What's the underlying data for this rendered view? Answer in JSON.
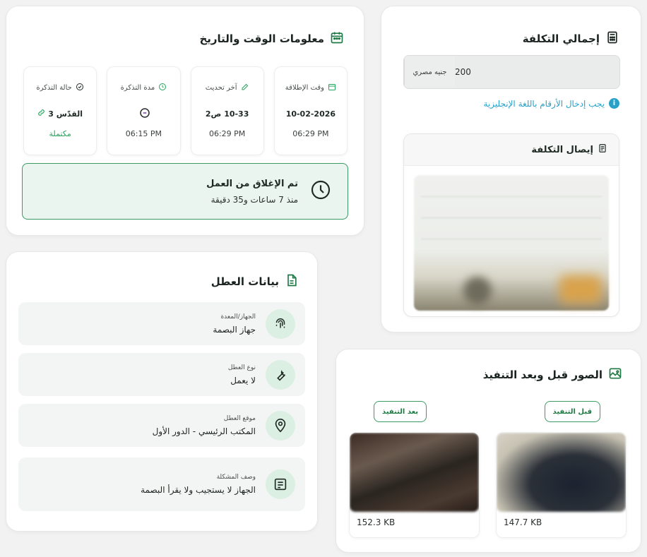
{
  "time_card": {
    "title": "معلومات الوقت والتاريخ",
    "stats": [
      {
        "label": "وقت الإطلاقة",
        "value": "10-02-2026",
        "sub": "06:29 PM"
      },
      {
        "label": "آخر تحديث",
        "value": "10-33 ص2",
        "sub": "06:29 PM"
      },
      {
        "label": "مدة التذكرة",
        "value": "",
        "sub": "06:15 PM"
      },
      {
        "label": "حالة التذكرة",
        "value": "القدّس 3",
        "sub": "مكتملة"
      }
    ],
    "closed_title": "تم الإغلاق من العمل",
    "closed_sub": "منذ 7 ساعات و35 دقيقة"
  },
  "cost_card": {
    "title": "إجمالي التكلفة",
    "value": "200",
    "unit": "جنيه مصري",
    "hint": "يجب إدخال الأرقام باللغة الإنجليزية",
    "receipt_title": "إيصال التكلفة"
  },
  "fault_card": {
    "title": "بيانات العطل",
    "rows": [
      {
        "label": "الجهاز/المعدة",
        "value": "جهاز البصمة"
      },
      {
        "label": "نوع العطل",
        "value": "لا يعمل"
      },
      {
        "label": "موقع العطل",
        "value": "المكتب الرئيسي - الدور الأول"
      },
      {
        "label": "وصف المشكلة",
        "value": "الجهاز لا يستجيب ولا يقرأ البصمة"
      }
    ]
  },
  "images_card": {
    "title": "الصور قبل وبعد التنفيذ",
    "before_label": "قبل التنفيذ",
    "after_label": "بعد التنفيذ",
    "before_size": "147.7 KB",
    "after_size": "152.3 KB"
  },
  "colors": {
    "accent": "#1f7a45",
    "accent_bg": "#e9f5ee",
    "info": "#27a1c9"
  }
}
